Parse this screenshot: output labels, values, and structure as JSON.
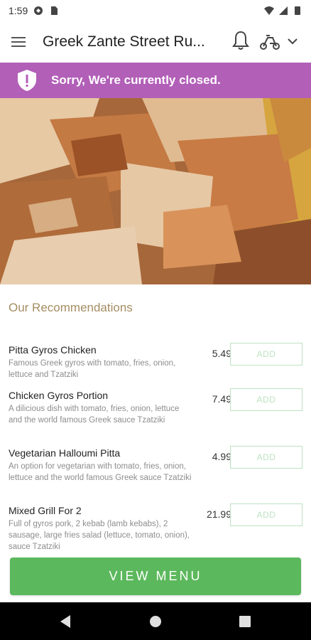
{
  "status_bar": {
    "time": "1:59"
  },
  "app_bar": {
    "title": "Greek Zante Street Ru..."
  },
  "closed_banner": {
    "text": "Sorry, We're currently closed."
  },
  "recommendations": {
    "title": "Our Recommendations",
    "items": [
      {
        "name": "Pitta Gyros Chicken",
        "description": "Famous Greek gyros with tomato, fries, onion, lettuce and Tzatziki",
        "price": "5.49",
        "add_label": "ADD"
      },
      {
        "name": "Chicken Gyros Portion",
        "description": "A dilicious dish with tomato, fries, onion, lettuce and the world famous Greek sauce Tzatziki",
        "price": "7.49",
        "add_label": "ADD"
      },
      {
        "name": "Vegetarian Halloumi Pitta",
        "description": "An option for vegetarian with tomato, fries, onion, lettuce and the world famous Greek sauce Tzatziki",
        "price": "4.99",
        "add_label": "ADD"
      },
      {
        "name": "Mixed Grill For 2",
        "description": "Full of gyros pork, 2 kebab (lamb kebabs), 2 sausage, large fries salad (lettuce, tomato, onion), sauce Tzatziki",
        "price": "21.99",
        "add_label": "ADD"
      }
    ]
  },
  "view_menu_label": "VIEW MENU",
  "colors": {
    "banner": "#b25fb8",
    "section_title": "#a58d63",
    "add_border": "#bde2c1",
    "view_menu": "#5cb85c"
  },
  "icons": [
    "menu-icon",
    "bell-icon",
    "delivery-icon",
    "chevron-down-icon",
    "shield-alert-icon",
    "back-icon",
    "home-icon",
    "recent-apps-icon"
  ]
}
